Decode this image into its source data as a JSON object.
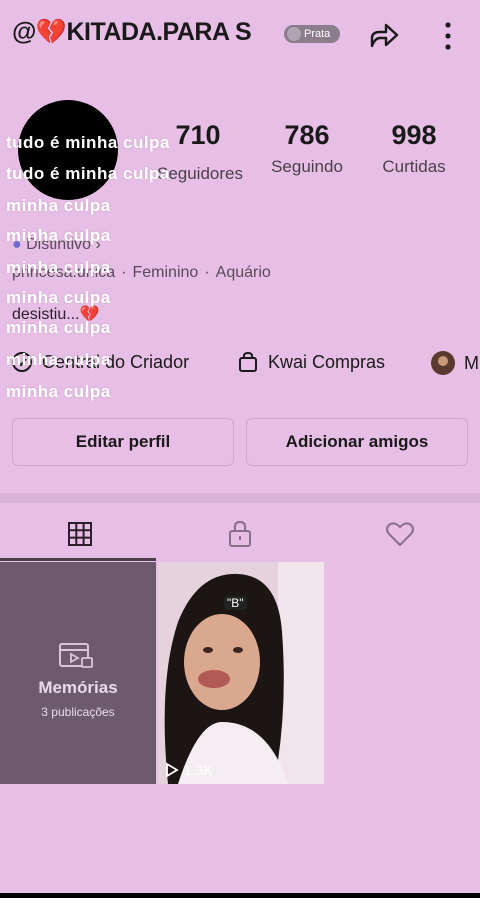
{
  "header": {
    "username": "@💔KITADA.PARA S",
    "badge_label": "Prata",
    "share_icon": "share-arrow-icon",
    "more_icon": "more-vertical-icon"
  },
  "stats": [
    {
      "value": "710",
      "label": "Seguidores"
    },
    {
      "value": "786",
      "label": "Seguindo"
    },
    {
      "value": "998",
      "label": "Curtidas"
    }
  ],
  "overlay_lines": [
    "tudo é minha culpa",
    "tudo é minha culpa",
    "minha culpa",
    "minha culpa",
    "minha culpa",
    "minha culpa",
    "minha culpa",
    "minha culpa",
    "minha culpa"
  ],
  "profile": {
    "distintivo": "Distintivo",
    "bio_name": "princesa.única",
    "gender": "Feminino",
    "sign": "Aquário",
    "bio_text": "desistiu...💔"
  },
  "links": {
    "creator": "Central do Criador",
    "shop": "Kwai Compras",
    "third": "M"
  },
  "buttons": {
    "edit": "Editar perfil",
    "add_friends": "Adicionar amigos"
  },
  "tabs": [
    "grid-icon",
    "lock-icon",
    "heart-icon"
  ],
  "memories": {
    "title": "Memórias",
    "count": "3 publicações"
  },
  "video": {
    "views": "1,3K",
    "sticker": "\"B\""
  }
}
